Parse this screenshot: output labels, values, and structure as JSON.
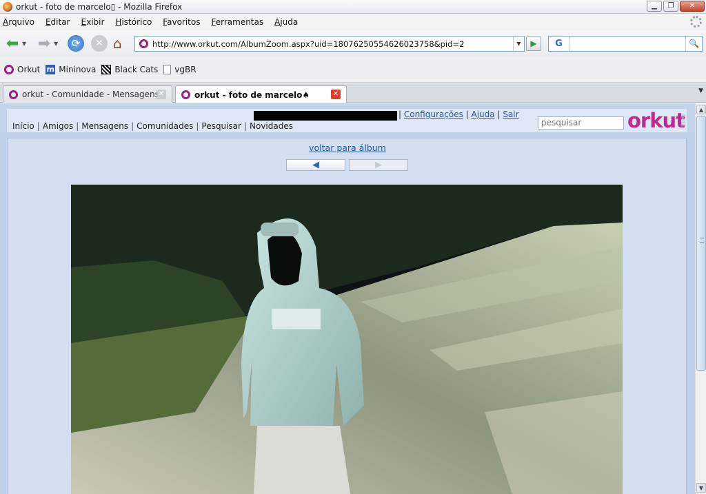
{
  "window": {
    "title": "orkut - foto de marcelo▯ - Mozilla Firefox"
  },
  "menu": [
    "Arquivo",
    "Editar",
    "Exibir",
    "Histórico",
    "Favoritos",
    "Ferramentas",
    "Ajuda"
  ],
  "toolbar": {
    "url": "http://www.orkut.com/AlbumZoom.aspx?uid=18076250554626023758&pid=2",
    "search_engine": "G"
  },
  "bookmarks": [
    "Orkut",
    "Mininova",
    "Black Cats",
    "vgBR"
  ],
  "tabs": [
    {
      "label": "orkut - Comunidade - Mensagens",
      "active": false
    },
    {
      "label": "orkut - foto de marcelo♠",
      "active": true
    }
  ],
  "orkut": {
    "top_links": [
      "Configurações",
      "Ajuda",
      "Sair"
    ],
    "nav_links": [
      "Início",
      "Amigos",
      "Mensagens",
      "Comunidades",
      "Pesquisar",
      "Novidades"
    ],
    "search_placeholder": "pesquisar",
    "logo": "orkut",
    "beta": "beta",
    "back_to_album": "voltar para álbum",
    "prev_arrow": "◀",
    "next_arrow": "▶"
  },
  "colors": {
    "orkut_pink": "#c2288f",
    "link_blue": "#2453a6",
    "page_bg": "#bfd0ea"
  }
}
